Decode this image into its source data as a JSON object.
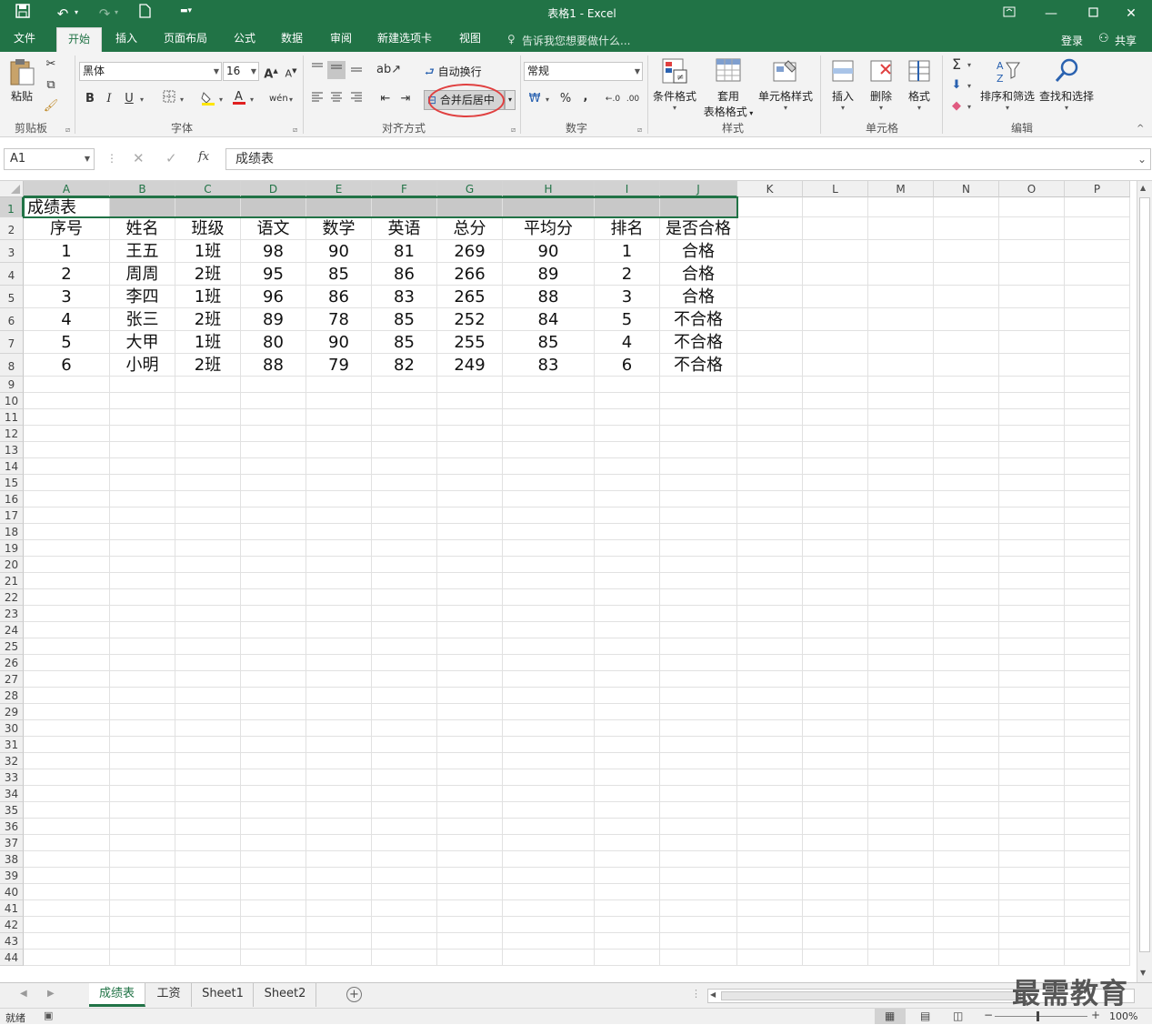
{
  "window": {
    "title": "表格1 - Excel"
  },
  "quick_access": {
    "save_icon": "save-icon",
    "undo_icon": "undo-icon",
    "redo_icon": "redo-icon",
    "new_icon": "new-file-icon",
    "customize_icon": "customize-qat-icon"
  },
  "tabs": [
    {
      "label": "文件"
    },
    {
      "label": "开始"
    },
    {
      "label": "插入"
    },
    {
      "label": "页面布局"
    },
    {
      "label": "公式"
    },
    {
      "label": "数据"
    },
    {
      "label": "审阅"
    },
    {
      "label": "新建选项卡"
    },
    {
      "label": "视图"
    }
  ],
  "tell_me": "告诉我您想要做什么...",
  "account": {
    "login": "登录",
    "share": "共享"
  },
  "ribbon": {
    "clipboard": {
      "label": "剪贴板",
      "paste": "粘贴"
    },
    "font": {
      "label": "字体",
      "font_name": "黑体",
      "font_size": "16",
      "bold": "B",
      "italic": "I",
      "underline": "U",
      "grow": "A",
      "shrink": "A",
      "phonetic": "wén"
    },
    "alignment": {
      "label": "对齐方式",
      "wrap_text": "自动换行",
      "merge_center": "合并后居中"
    },
    "number": {
      "label": "数字",
      "format": "常规",
      "percent": "%",
      "comma": ","
    },
    "styles": {
      "label": "样式",
      "conditional": "条件格式",
      "table_format_1": "套用",
      "table_format_2": "表格格式",
      "cell_styles": "单元格样式"
    },
    "cells": {
      "label": "单元格",
      "insert": "插入",
      "delete": "删除",
      "format": "格式"
    },
    "editing": {
      "label": "编辑",
      "sort_filter": "排序和筛选",
      "find_select": "查找和选择"
    }
  },
  "formula_bar": {
    "name_box": "A1",
    "fx": "fx",
    "content": "成绩表"
  },
  "columns": [
    "A",
    "B",
    "C",
    "D",
    "E",
    "F",
    "G",
    "H",
    "I",
    "J",
    "K",
    "L",
    "M",
    "N",
    "O",
    "P"
  ],
  "rows_visible": 44,
  "sheet": {
    "title": "成绩表",
    "headers": [
      "序号",
      "姓名",
      "班级",
      "语文",
      "数学",
      "英语",
      "总分",
      "平均分",
      "排名",
      "是否合格"
    ],
    "rows": [
      [
        "1",
        "王五",
        "1班",
        "98",
        "90",
        "81",
        "269",
        "90",
        "1",
        "合格"
      ],
      [
        "2",
        "周周",
        "2班",
        "95",
        "85",
        "86",
        "266",
        "89",
        "2",
        "合格"
      ],
      [
        "3",
        "李四",
        "1班",
        "96",
        "86",
        "83",
        "265",
        "88",
        "3",
        "合格"
      ],
      [
        "4",
        "张三",
        "2班",
        "89",
        "78",
        "85",
        "252",
        "84",
        "5",
        "不合格"
      ],
      [
        "5",
        "大甲",
        "1班",
        "80",
        "90",
        "85",
        "255",
        "85",
        "4",
        "不合格"
      ],
      [
        "6",
        "小明",
        "2班",
        "88",
        "79",
        "82",
        "249",
        "83",
        "6",
        "不合格"
      ]
    ]
  },
  "sheet_tabs": [
    {
      "label": "成绩表"
    },
    {
      "label": "工资"
    },
    {
      "label": "Sheet1"
    },
    {
      "label": "Sheet2"
    }
  ],
  "status": {
    "ready": "就绪",
    "zoom": "100%"
  },
  "watermark": "最需教育",
  "colors": {
    "accent": "#217346",
    "highlight": "#e04040"
  }
}
